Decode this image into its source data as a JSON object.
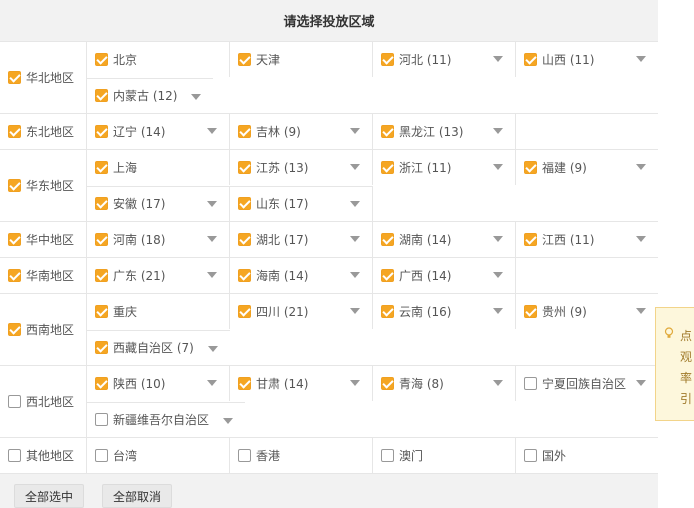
{
  "header": {
    "title": "请选择投放区域"
  },
  "regions": [
    {
      "name": "华北地区",
      "checked": true,
      "provinces": [
        {
          "label": "北京",
          "checked": true,
          "dropdown": false
        },
        {
          "label": "天津",
          "checked": true,
          "dropdown": false
        },
        {
          "label": "河北 (11)",
          "checked": true,
          "dropdown": true
        },
        {
          "label": "山西 (11)",
          "checked": true,
          "dropdown": true
        },
        {
          "label": "内蒙古 (12)",
          "checked": true,
          "dropdown": true
        }
      ]
    },
    {
      "name": "东北地区",
      "checked": true,
      "provinces": [
        {
          "label": "辽宁 (14)",
          "checked": true,
          "dropdown": true
        },
        {
          "label": "吉林 (9)",
          "checked": true,
          "dropdown": true
        },
        {
          "label": "黑龙江 (13)",
          "checked": true,
          "dropdown": true
        }
      ]
    },
    {
      "name": "华东地区",
      "checked": true,
      "provinces": [
        {
          "label": "上海",
          "checked": true,
          "dropdown": false
        },
        {
          "label": "江苏 (13)",
          "checked": true,
          "dropdown": true
        },
        {
          "label": "浙江 (11)",
          "checked": true,
          "dropdown": true
        },
        {
          "label": "福建 (9)",
          "checked": true,
          "dropdown": true
        },
        {
          "label": "安徽 (17)",
          "checked": true,
          "dropdown": true
        },
        {
          "label": "山东 (17)",
          "checked": true,
          "dropdown": true
        }
      ]
    },
    {
      "name": "华中地区",
      "checked": true,
      "provinces": [
        {
          "label": "河南 (18)",
          "checked": true,
          "dropdown": true
        },
        {
          "label": "湖北 (17)",
          "checked": true,
          "dropdown": true
        },
        {
          "label": "湖南 (14)",
          "checked": true,
          "dropdown": true
        },
        {
          "label": "江西 (11)",
          "checked": true,
          "dropdown": true
        }
      ]
    },
    {
      "name": "华南地区",
      "checked": true,
      "provinces": [
        {
          "label": "广东 (21)",
          "checked": true,
          "dropdown": true
        },
        {
          "label": "海南 (14)",
          "checked": true,
          "dropdown": true
        },
        {
          "label": "广西 (14)",
          "checked": true,
          "dropdown": true
        }
      ]
    },
    {
      "name": "西南地区",
      "checked": true,
      "provinces": [
        {
          "label": "重庆",
          "checked": true,
          "dropdown": false
        },
        {
          "label": "四川 (21)",
          "checked": true,
          "dropdown": true
        },
        {
          "label": "云南 (16)",
          "checked": true,
          "dropdown": true
        },
        {
          "label": "贵州 (9)",
          "checked": true,
          "dropdown": true
        },
        {
          "label": "西藏自治区 (7)",
          "checked": true,
          "dropdown": true
        }
      ]
    },
    {
      "name": "西北地区",
      "checked": false,
      "provinces": [
        {
          "label": "陕西 (10)",
          "checked": true,
          "dropdown": true
        },
        {
          "label": "甘肃 (14)",
          "checked": true,
          "dropdown": true
        },
        {
          "label": "青海 (8)",
          "checked": true,
          "dropdown": true
        },
        {
          "label": "宁夏回族自治区",
          "checked": false,
          "dropdown": true
        },
        {
          "label": "新疆维吾尔自治区",
          "checked": false,
          "dropdown": true
        }
      ]
    },
    {
      "name": "其他地区",
      "checked": false,
      "provinces": [
        {
          "label": "台湾",
          "checked": false,
          "dropdown": false
        },
        {
          "label": "香港",
          "checked": false,
          "dropdown": false
        },
        {
          "label": "澳门",
          "checked": false,
          "dropdown": false
        },
        {
          "label": "国外",
          "checked": false,
          "dropdown": false
        }
      ]
    }
  ],
  "actions": {
    "select_all": "全部选中",
    "deselect_all": "全部取消"
  },
  "tooltip": {
    "lines": [
      "点",
      "观",
      "率",
      "引"
    ]
  },
  "colors": {
    "accent": "#f5a623",
    "border": "#e6e6e6",
    "header_bg": "#f2f2f2"
  }
}
